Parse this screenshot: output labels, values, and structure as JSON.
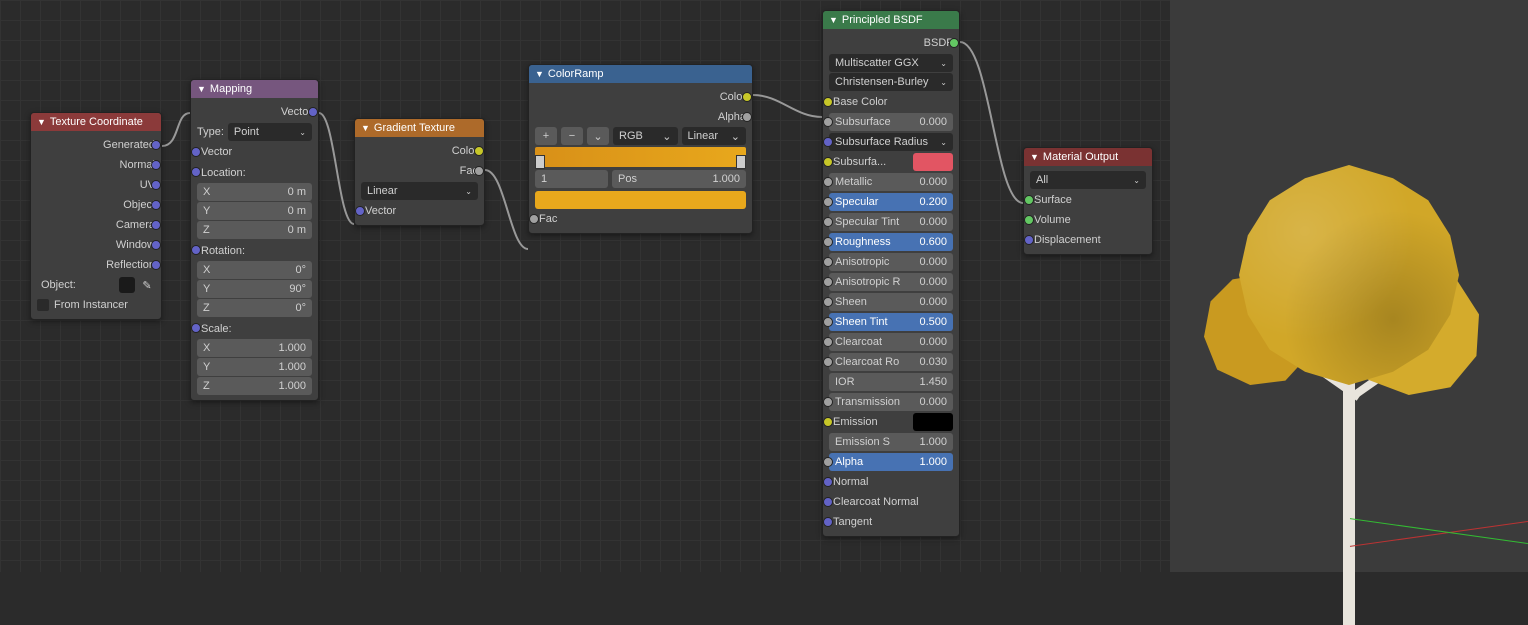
{
  "texcoord": {
    "title": "Texture Coordinate",
    "outs": [
      "Generated",
      "Normal",
      "UV",
      "Object",
      "Camera",
      "Window",
      "Reflection"
    ],
    "object_label": "Object:",
    "from_instancer": "From Instancer"
  },
  "mapping": {
    "title": "Mapping",
    "out_vector": "Vector",
    "type_label": "Type:",
    "type_value": "Point",
    "in_vector": "Vector",
    "sections": [
      "Location:",
      "Rotation:",
      "Scale:"
    ],
    "loc": [
      [
        "X",
        "0 m"
      ],
      [
        "Y",
        "0 m"
      ],
      [
        "Z",
        "0 m"
      ]
    ],
    "rot": [
      [
        "X",
        "0°"
      ],
      [
        "Y",
        "90°"
      ],
      [
        "Z",
        "0°"
      ]
    ],
    "scale": [
      [
        "X",
        "1.000"
      ],
      [
        "Y",
        "1.000"
      ],
      [
        "Z",
        "1.000"
      ]
    ]
  },
  "gradient": {
    "title": "Gradient Texture",
    "out_color": "Color",
    "out_fac": "Fac",
    "mode": "Linear",
    "in_vector": "Vector"
  },
  "colorramp": {
    "title": "ColorRamp",
    "out_color": "Color",
    "out_alpha": "Alpha",
    "mode_a": "RGB",
    "mode_b": "Linear",
    "stop_index": "1",
    "pos_label": "Pos",
    "pos_value": "1.000",
    "in_fac": "Fac"
  },
  "bsdf": {
    "title": "Principled BSDF",
    "out": "BSDF",
    "dist": "Multiscatter GGX",
    "sss": "Christensen-Burley",
    "base_color": "Base Color",
    "params": [
      [
        "Subsurface",
        "0.000",
        "plain"
      ],
      [
        "Subsurface Radius",
        "",
        "dd"
      ],
      [
        "Subsurfa...",
        "",
        "color"
      ],
      [
        "Metallic",
        "0.000",
        "plain"
      ],
      [
        "Specular",
        "0.200",
        "blue"
      ],
      [
        "Specular Tint",
        "0.000",
        "plain"
      ],
      [
        "Roughness",
        "0.600",
        "blue"
      ],
      [
        "Anisotropic",
        "0.000",
        "plain"
      ],
      [
        "Anisotropic R",
        "0.000",
        "plain"
      ],
      [
        "Sheen",
        "0.000",
        "plain"
      ],
      [
        "Sheen Tint",
        "0.500",
        "blue"
      ],
      [
        "Clearcoat",
        "0.000",
        "plain"
      ],
      [
        "Clearcoat Ro",
        "0.030",
        "plain"
      ],
      [
        "IOR",
        "1.450",
        "plain-nosock"
      ],
      [
        "Transmission",
        "0.000",
        "plain"
      ],
      [
        "Emission",
        "",
        "black"
      ],
      [
        "Emission S",
        "1.000",
        "plain-nosock"
      ],
      [
        "Alpha",
        "1.000",
        "blue"
      ]
    ],
    "ins": [
      "Normal",
      "Clearcoat Normal",
      "Tangent"
    ]
  },
  "output": {
    "title": "Material Output",
    "target": "All",
    "ins": [
      "Surface",
      "Volume",
      "Displacement"
    ]
  }
}
